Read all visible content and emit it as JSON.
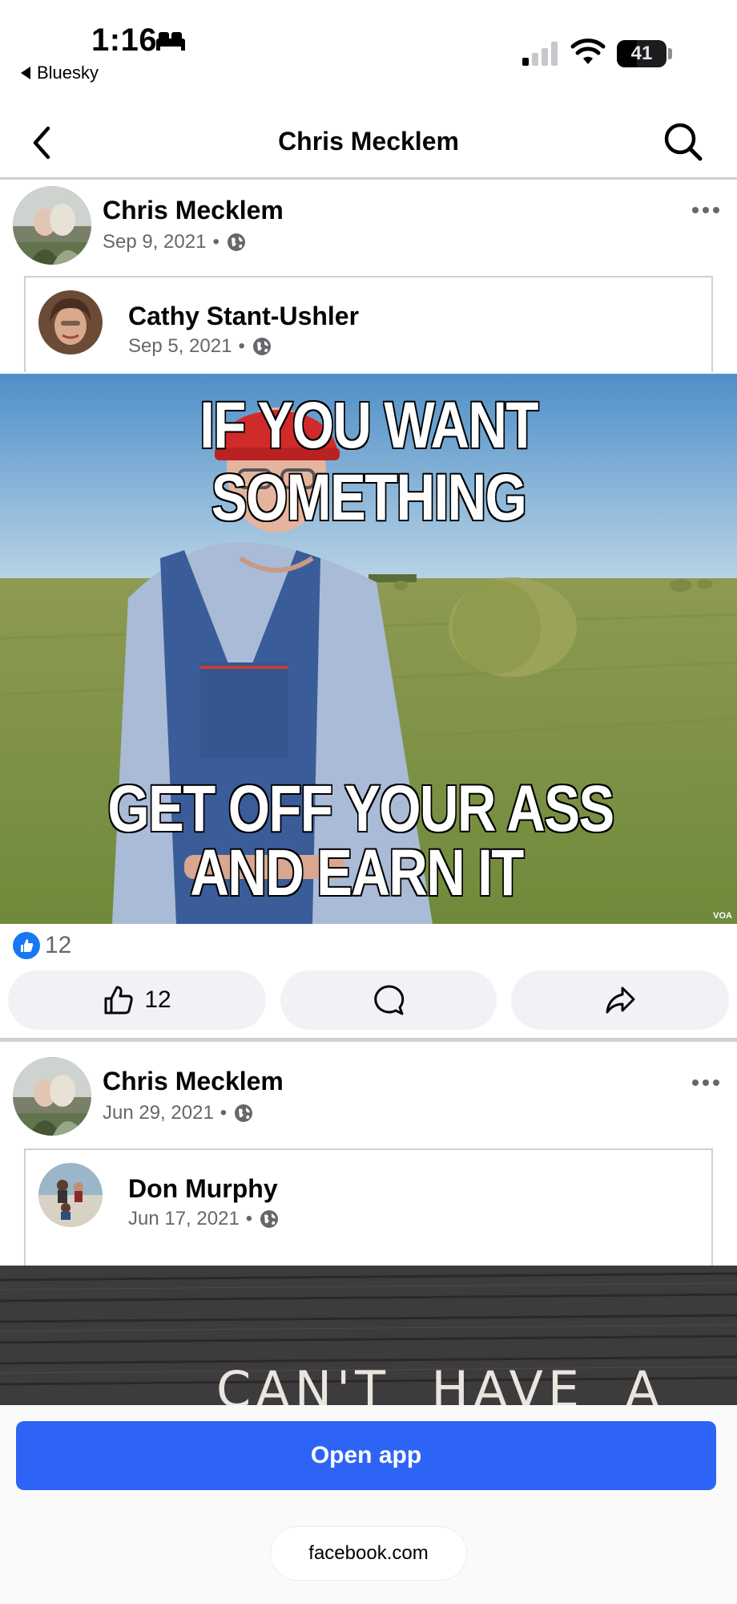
{
  "status_bar": {
    "time": "1:16",
    "back_app": "Bluesky",
    "battery": "41"
  },
  "header": {
    "title": "Chris Mecklem"
  },
  "posts": [
    {
      "author": "Chris Mecklem",
      "date": "Sep 9, 2021",
      "shared": {
        "author": "Cathy Stant-Ushler",
        "date": "Sep 5, 2021"
      },
      "meme": {
        "top_text": "IF YOU WANT SOMETHING",
        "bottom_text_1": "GET OFF YOUR ASS",
        "bottom_text_2": "AND EARN IT",
        "watermark": "VOA"
      },
      "reaction_count": "12",
      "like_button_count": "12"
    },
    {
      "author": "Chris Mecklem",
      "date": "Jun 29, 2021",
      "shared": {
        "author": "Don Murphy",
        "date": "Jun 17, 2021"
      },
      "sign_text": "CAN'T  HAVE  A"
    }
  ],
  "bottom": {
    "open_app": "Open app",
    "url": "facebook.com"
  },
  "colors": {
    "accent": "#2d64f5",
    "like_blue": "#1877f2",
    "meta_gray": "#65676b"
  }
}
